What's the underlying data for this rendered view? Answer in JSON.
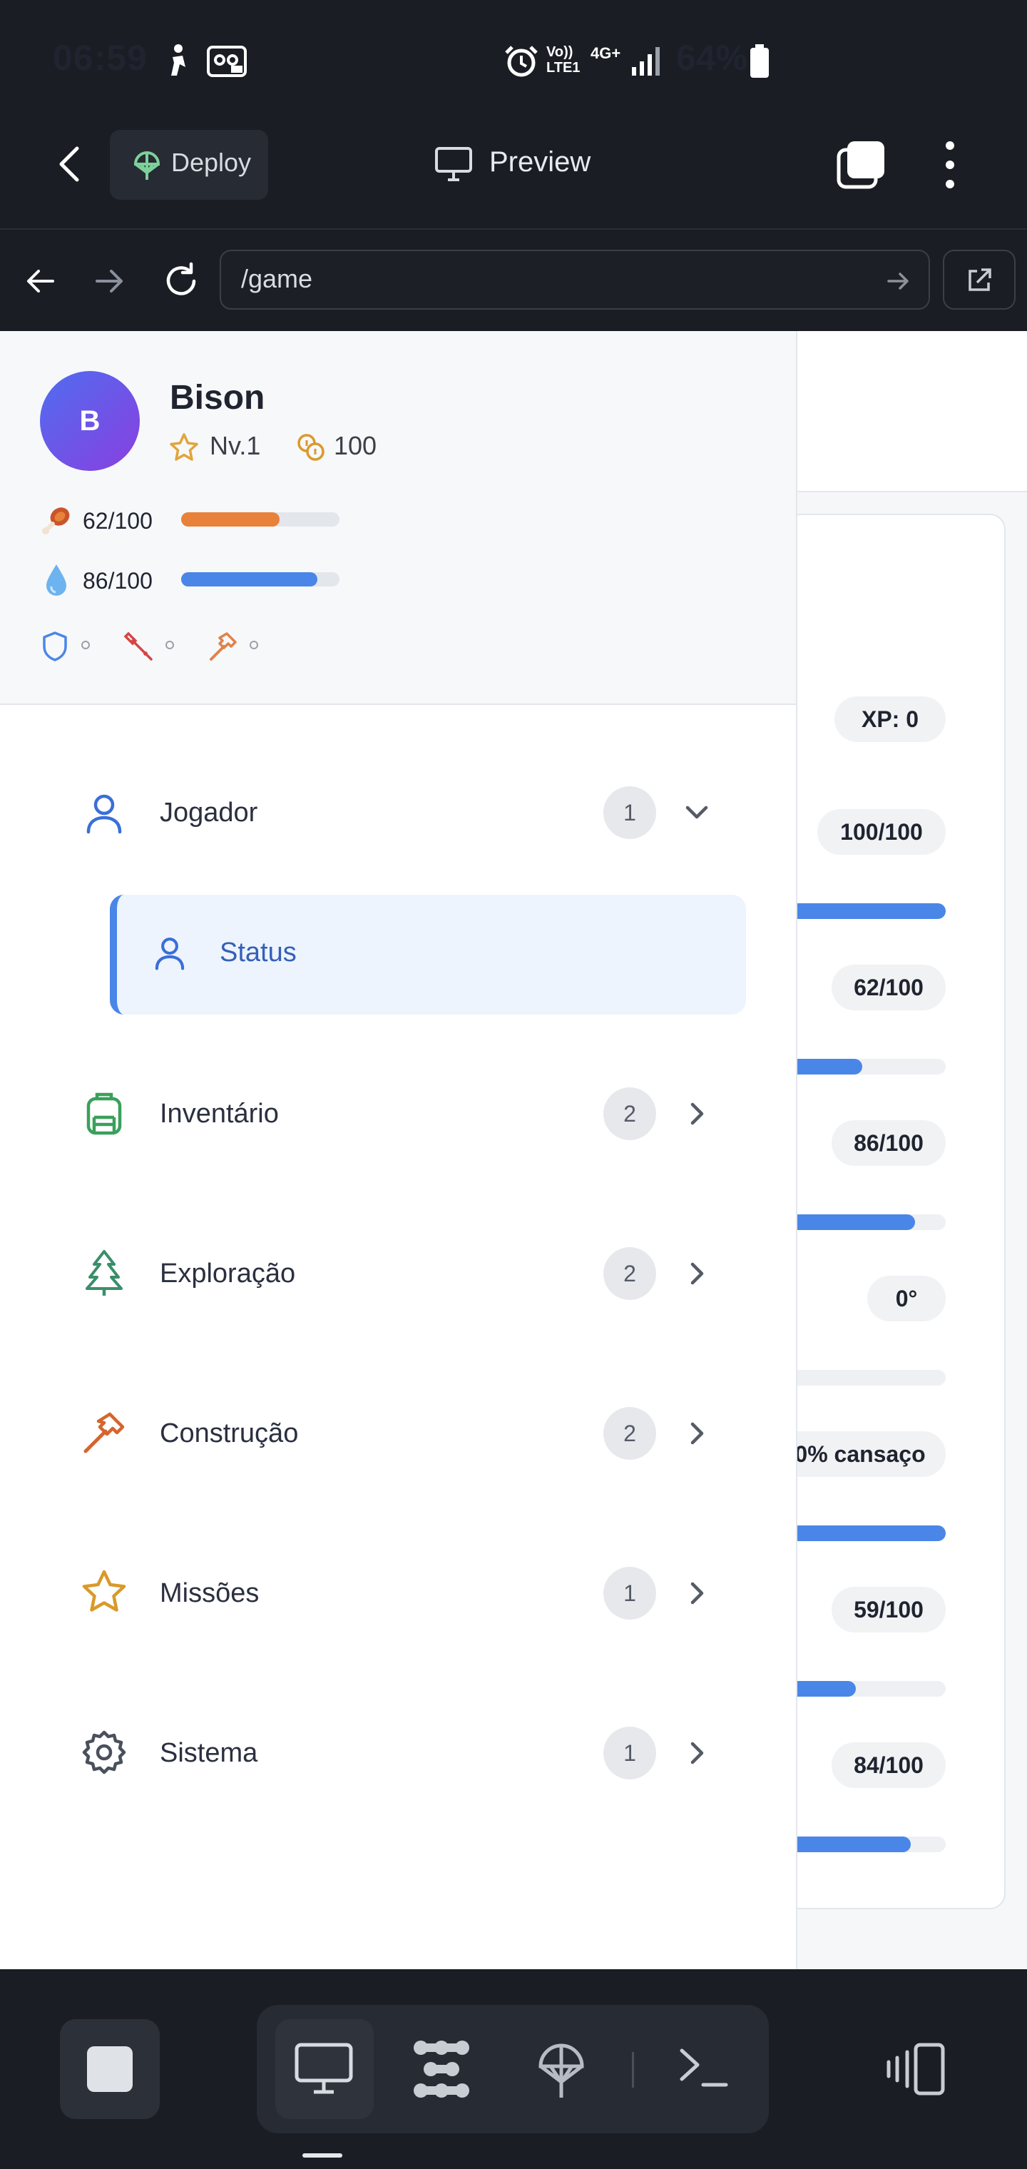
{
  "status_bar": {
    "time": "06:59",
    "network": "Vo)) LTE1",
    "net_type": "4G+",
    "battery": "64%"
  },
  "header": {
    "deploy_label": "Deploy",
    "preview_label": "Preview"
  },
  "browser": {
    "url": "/game"
  },
  "player": {
    "avatar_initial": "B",
    "name": "Bison",
    "level": "Nv.1",
    "coins": "100",
    "hunger": {
      "text": "62/100",
      "value": 0.62,
      "color": "#e8813a"
    },
    "thirst": {
      "text": "86/100",
      "value": 0.86,
      "color": "#4a86e8"
    },
    "equipment": [
      "shield-icon",
      "sword-icon",
      "hammer-icon"
    ]
  },
  "menu": {
    "items": [
      {
        "label": "Jogador",
        "badge": "1",
        "icon": "user-icon",
        "expanded": true
      },
      {
        "label": "Inventário",
        "badge": "2",
        "icon": "backpack-icon"
      },
      {
        "label": "Exploração",
        "badge": "2",
        "icon": "tree-icon"
      },
      {
        "label": "Construção",
        "badge": "2",
        "icon": "hammer-icon"
      },
      {
        "label": "Missões",
        "badge": "1",
        "icon": "star-icon"
      },
      {
        "label": "Sistema",
        "badge": "1",
        "icon": "gear-icon"
      }
    ],
    "sub_item": {
      "label": "Status",
      "icon": "user-icon"
    }
  },
  "stats_panel": {
    "xp": "XP: 0",
    "rows": [
      {
        "text": "100/100",
        "value": 1.0
      },
      {
        "text": "62/100",
        "value": 0.62
      },
      {
        "text": "86/100",
        "value": 0.86
      },
      {
        "text": "0°",
        "value": 0.0
      },
      {
        "text": "0% cansaço",
        "value": 1.0
      },
      {
        "text": "59/100",
        "value": 0.59
      },
      {
        "text": "84/100",
        "value": 0.84
      }
    ]
  },
  "colors": {
    "accent": "#4a86e8",
    "hunger": "#e8813a",
    "dark_bg": "#1a1d23"
  }
}
